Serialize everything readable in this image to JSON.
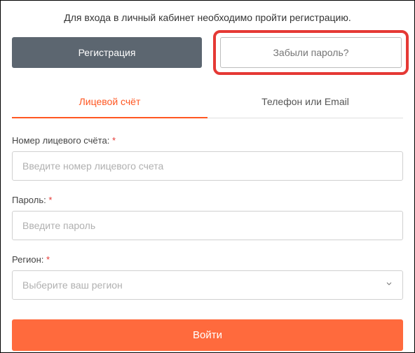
{
  "intro": "Для входа в личный кабинет необходимо пройти регистрацию.",
  "buttons": {
    "register": "Регистрация",
    "forgot": "Забыли пароль?"
  },
  "tabs": {
    "account": "Лицевой счёт",
    "phone_email": "Телефон или Email"
  },
  "form": {
    "account_label": "Номер лицевого счёта:",
    "account_placeholder": "Введите номер лицевого счета",
    "password_label": "Пароль:",
    "password_placeholder": "Введите пароль",
    "region_label": "Регион:",
    "region_placeholder": "Выберите ваш регион",
    "required_mark": "*",
    "submit": "Войти"
  }
}
